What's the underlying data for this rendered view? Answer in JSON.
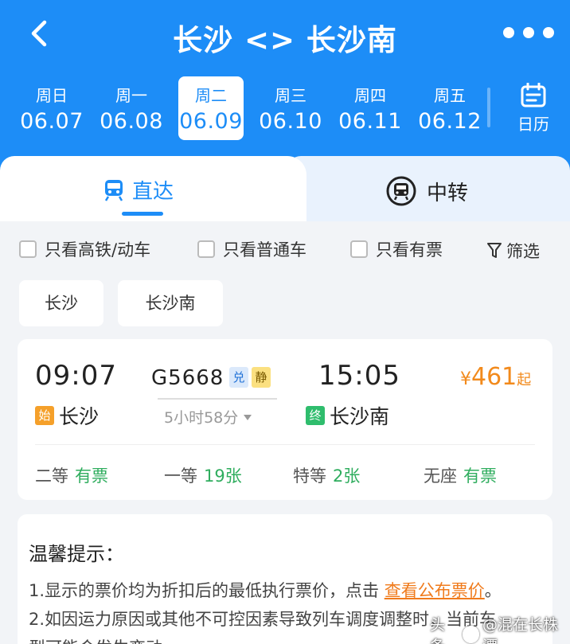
{
  "header": {
    "title": "长沙 <> 长沙南",
    "back_icon": "chevron-left-icon",
    "more_icon": "more-dots-icon"
  },
  "dates": [
    {
      "weekday": "周日",
      "date": "06.07",
      "active": false
    },
    {
      "weekday": "周一",
      "date": "06.08",
      "active": false
    },
    {
      "weekday": "周二",
      "date": "06.09",
      "active": true
    },
    {
      "weekday": "周三",
      "date": "06.10",
      "active": false
    },
    {
      "weekday": "周四",
      "date": "06.11",
      "active": false
    },
    {
      "weekday": "周五",
      "date": "06.12",
      "active": false
    }
  ],
  "calendar": {
    "label": "日历",
    "icon": "calendar-icon"
  },
  "tabs": {
    "direct": {
      "label": "直达",
      "icon": "train-icon"
    },
    "transfer": {
      "label": "中转",
      "icon": "transfer-train-icon"
    }
  },
  "filters": [
    {
      "label": "只看高铁/动车",
      "checked": false
    },
    {
      "label": "只看普通车",
      "checked": false
    },
    {
      "label": "只看有票",
      "checked": false
    }
  ],
  "screen": {
    "label": "筛选",
    "icon": "filter-icon"
  },
  "stations": {
    "from": "长沙",
    "to": "长沙南"
  },
  "train": {
    "depart_time": "09:07",
    "arrive_time": "15:05",
    "number": "G5668",
    "badge_dui": "兑",
    "badge_jing": "静",
    "price_currency": "¥",
    "price_value": "461",
    "price_suffix": "起",
    "duration": "5小时58分",
    "start_tag": "始",
    "start_station": "长沙",
    "end_tag": "终",
    "end_station": "长沙南",
    "seats": [
      {
        "class": "二等",
        "status": "有票"
      },
      {
        "class": "一等",
        "status": "19张"
      },
      {
        "class": "特等",
        "status": "2张"
      },
      {
        "class": "无座",
        "status": "有票"
      }
    ]
  },
  "tips": {
    "title": "温馨提示：",
    "line1_pre": "1.显示的票价均为折扣后的最低执行票价，点击 ",
    "line1_link": "查看公布票价",
    "line1_post": "。",
    "line2": "2.如因运力原因或其他不可控因素导致列车调度调整时，当前车",
    "line3": "型可能会发生变动。"
  },
  "watermark": {
    "prefix": "头条",
    "handle": "@混在长株潭"
  },
  "colors": {
    "brand": "#1d8df7",
    "price": "#f28a1c",
    "ticket_available": "#2fad5e"
  }
}
